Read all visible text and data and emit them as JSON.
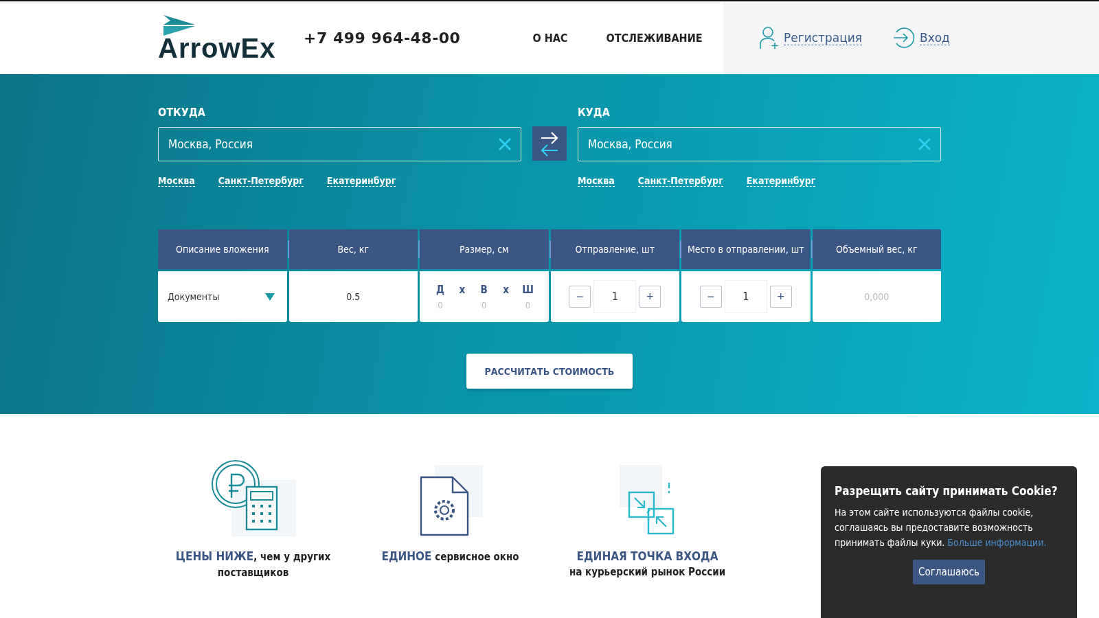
{
  "header": {
    "logo": "ArrowEx",
    "phone": "+7 499 964-48-00",
    "nav": [
      {
        "label": "О НАС"
      },
      {
        "label": "ОТСЛЕЖИВАНИЕ"
      }
    ],
    "account": [
      {
        "kind": "register",
        "label": "Регистрация"
      },
      {
        "kind": "login",
        "label": "Вход"
      }
    ]
  },
  "route": [
    {
      "label": "ОТКУДА",
      "value": "Москва, Россия",
      "quick": [
        "Москва",
        "Санкт-Петербург",
        "Екатеринбург"
      ]
    },
    {
      "label": "КУДА",
      "value": "Москва, Россия",
      "quick": [
        "Москва",
        "Санкт-Петербург",
        "Екатеринбург"
      ]
    }
  ],
  "parcel": {
    "columns": [
      "Описание вложения",
      "Вес, кг",
      "Размер, см",
      "Отправление, шт",
      "Место в отправлении, шт",
      "Объемный вес, кг"
    ],
    "description": "Документы",
    "weight": "0.5",
    "size": {
      "labels": [
        "Д",
        "х",
        "В",
        "х",
        "Ш"
      ],
      "values": [
        "0",
        "0",
        "0"
      ]
    },
    "counters": [
      {
        "minus": "−",
        "value": "1",
        "plus": "+"
      },
      {
        "minus": "−",
        "value": "1",
        "plus": "+"
      }
    ],
    "volume_weight": {
      "placeholder": "0,000"
    }
  },
  "calculate_button": "РАССЧИТАТЬ СТОИМОСТЬ",
  "features": [
    {
      "accent": "ЦЕНЫ НИЖЕ",
      "rest": ", чем у других поставщиков",
      "stacked": false
    },
    {
      "accent": "ЕДИНОЕ",
      "rest": " сервисное окно",
      "stacked": false
    },
    {
      "accent": "ЕДИНАЯ ТОЧКА ВХОДА",
      "rest": "на курьерский рынок России",
      "stacked": true
    }
  ],
  "cookie": {
    "title": "Разрещить сайту принимать Cookie?",
    "text": "На этом сайте используются файлы cookie, соглашаясь вы предоставите возможность принимать файлы куки.",
    "link": "Больше информации.",
    "button": "Соглашаюсь"
  }
}
